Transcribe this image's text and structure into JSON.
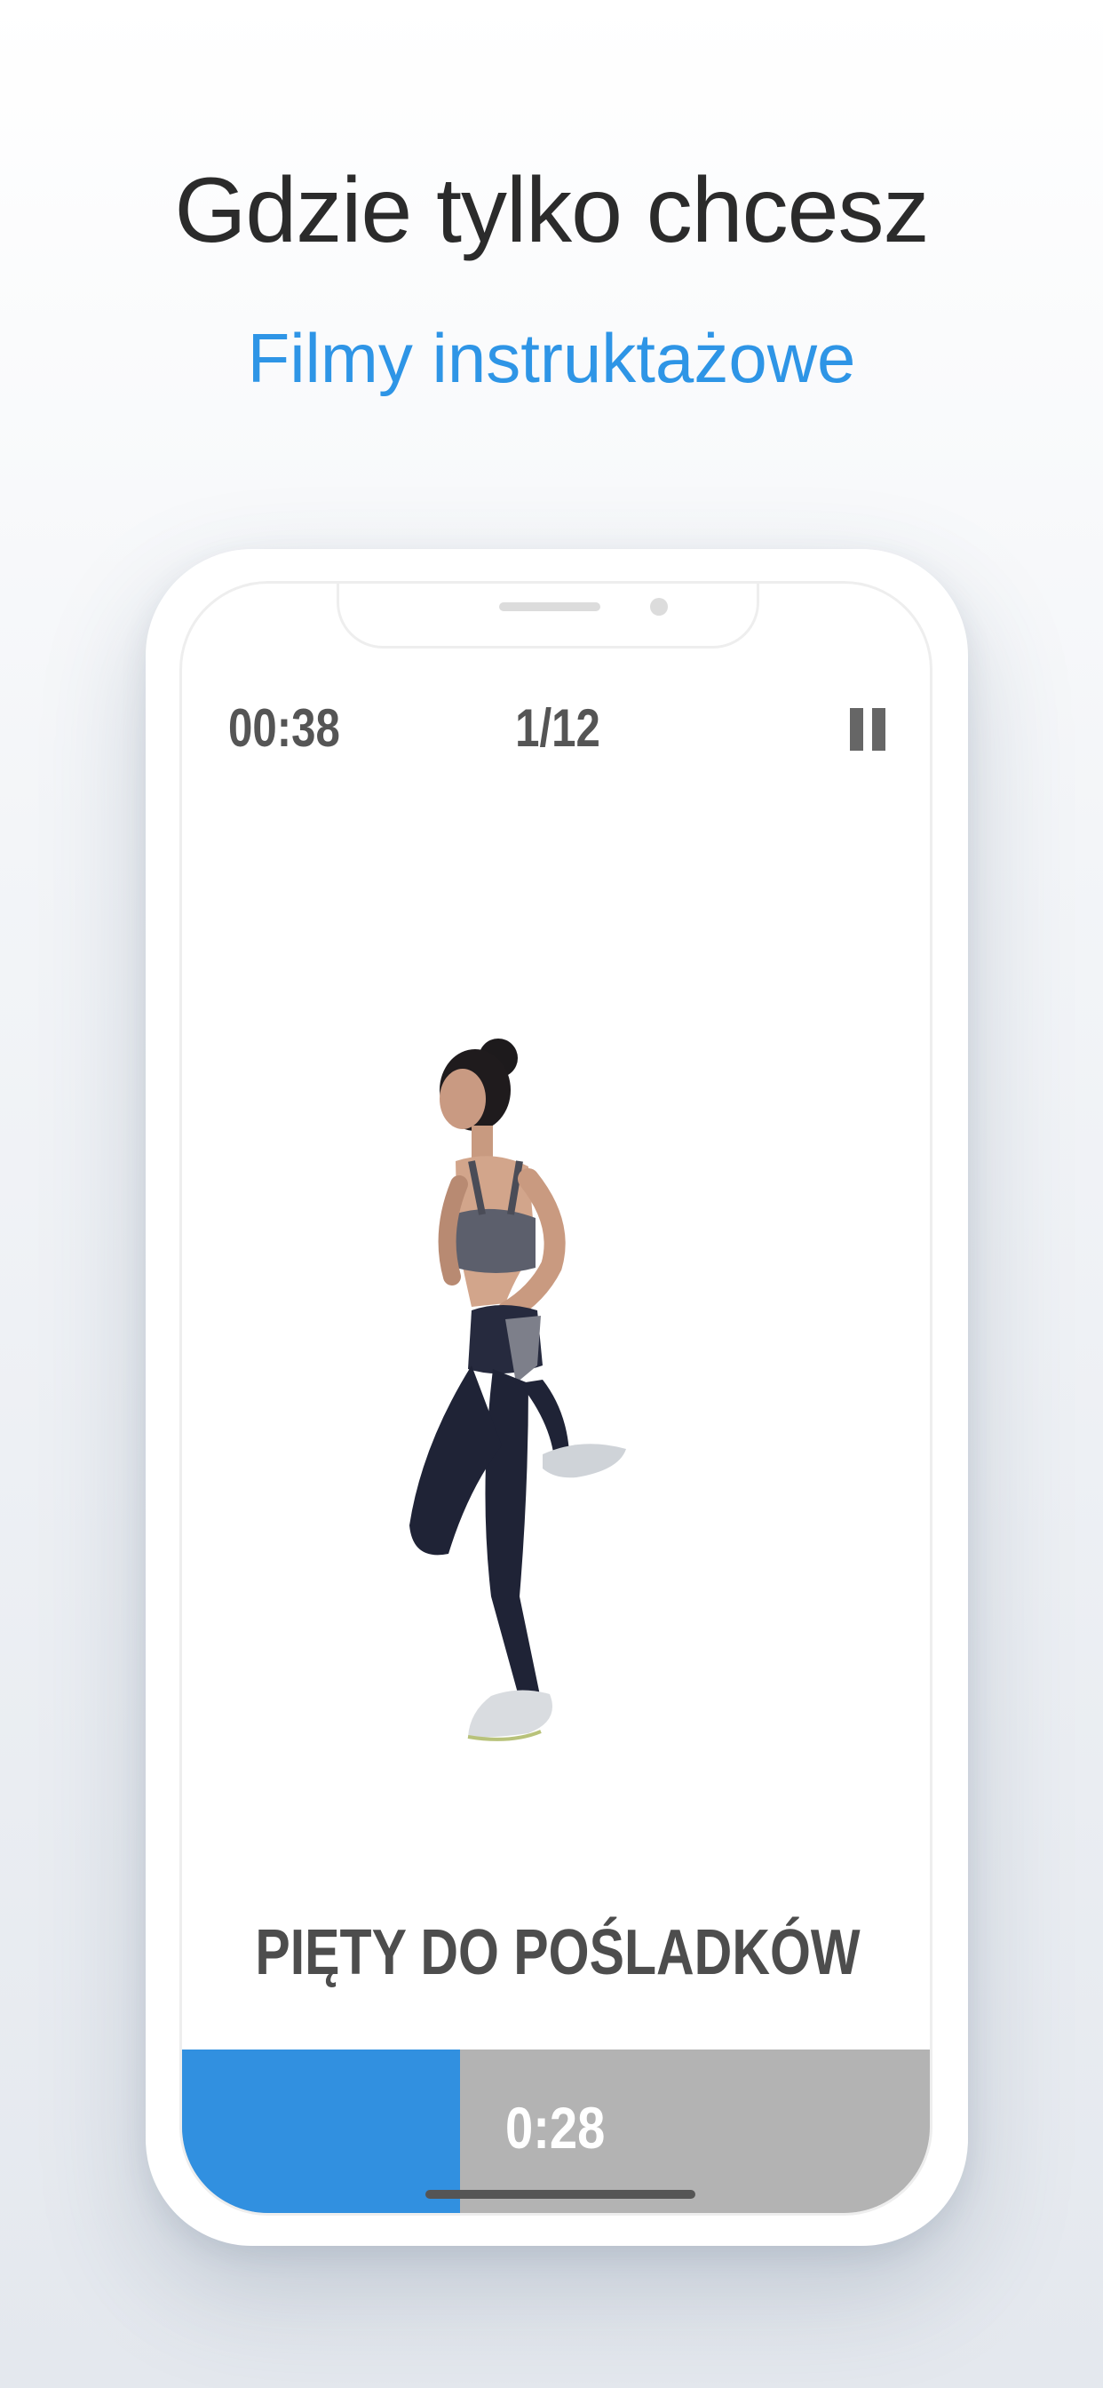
{
  "header": {
    "title": "Gdzie tylko chcesz",
    "subtitle": "Filmy instruktażowe"
  },
  "workout": {
    "elapsed_time": "00:38",
    "exercise_counter": "1/12",
    "exercise_name": "PIĘTY DO POŚLADKÓW",
    "remaining_time": "0:28",
    "progress_fraction": 0.37
  },
  "icons": {
    "pause": "pause-icon"
  },
  "colors": {
    "accent": "#3190E0",
    "subtitle": "#2E95E6",
    "progress_track": "#B3B3B3"
  }
}
